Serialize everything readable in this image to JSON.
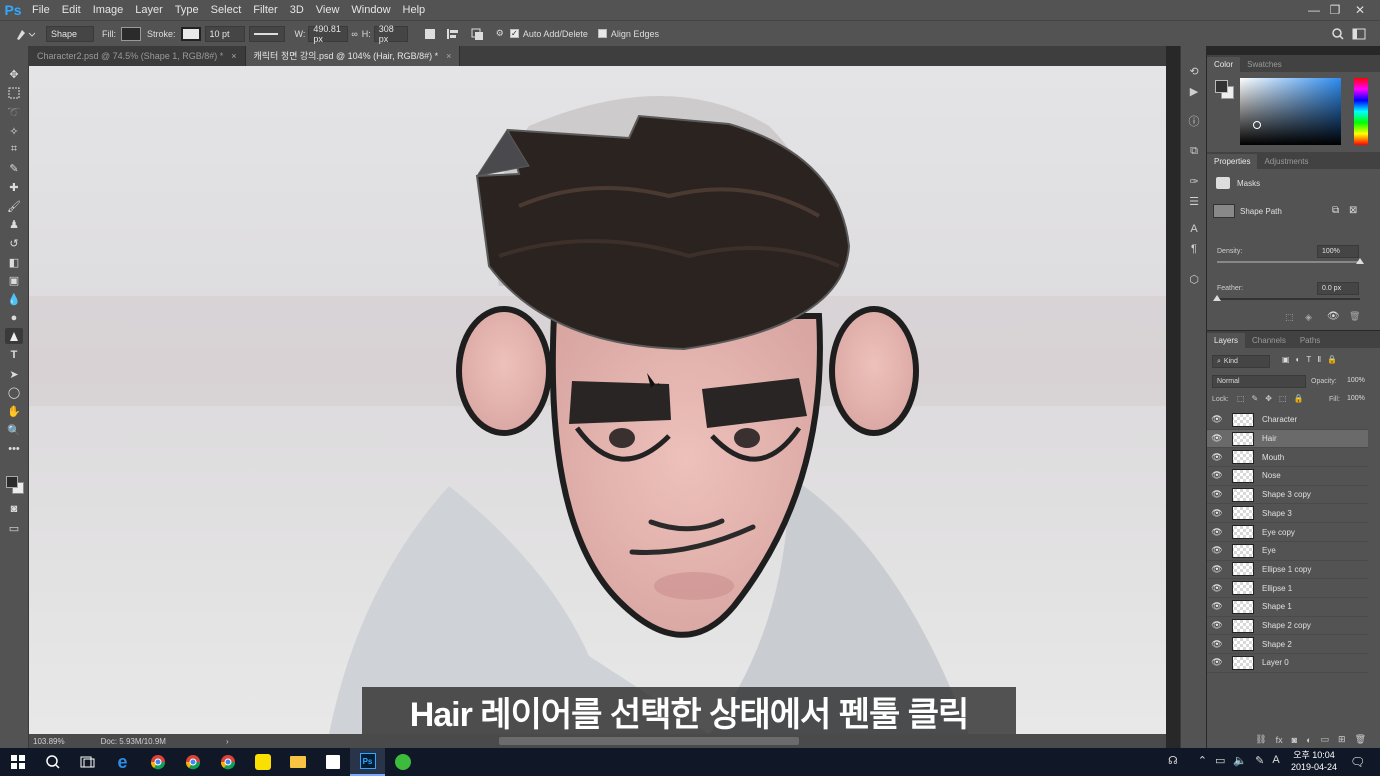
{
  "app": {
    "logo": "Ps"
  },
  "menu": [
    "File",
    "Edit",
    "Image",
    "Layer",
    "Type",
    "Select",
    "Filter",
    "3D",
    "View",
    "Window",
    "Help"
  ],
  "window_controls": {
    "minimize": "—",
    "restore": "❐",
    "close": "✕"
  },
  "options": {
    "tool_mode": "Shape",
    "fill_label": "Fill:",
    "stroke_label": "Stroke:",
    "stroke_width": "10 pt",
    "w_label": "W:",
    "w_value": "490.81 px",
    "h_label": "H:",
    "h_value": "308 px",
    "auto_add_delete": "Auto Add/Delete",
    "align_edges": "Align Edges"
  },
  "doc_tabs": [
    {
      "label": "Character2.psd @ 74.5% (Shape 1, RGB/8#) *",
      "close": "×"
    },
    {
      "label": "캐릭터 정면 강의.psd @ 104% (Hair, RGB/8#) *",
      "close": "×"
    }
  ],
  "status": {
    "zoom": "103.89%",
    "doc": "Doc: 5.93M/10.9M",
    "arrow": "›"
  },
  "color_panel": {
    "tabs": [
      "Color",
      "Swatches"
    ]
  },
  "properties_panel": {
    "tabs": [
      "Properties",
      "Adjustments"
    ],
    "masks_label": "Masks",
    "shape_path_label": "Shape Path",
    "density_label": "Density:",
    "density_value": "100%",
    "density": 1.0,
    "feather_label": "Feather:",
    "feather_value": "0.0 px",
    "feather": 0.0
  },
  "layers_panel": {
    "tabs": [
      "Layers",
      "Channels",
      "Paths"
    ],
    "kind_label": "Kind",
    "blend_mode": "Normal",
    "opacity_label": "Opacity:",
    "opacity_value": "100%",
    "lock_label": "Lock:",
    "fill_label": "Fill:",
    "fill_value": "100%",
    "layers": [
      {
        "name": "Character",
        "selected": false
      },
      {
        "name": "Hair",
        "selected": true
      },
      {
        "name": "Mouth",
        "selected": false
      },
      {
        "name": "Nose",
        "selected": false
      },
      {
        "name": "Shape 3 copy",
        "selected": false
      },
      {
        "name": "Shape 3",
        "selected": false
      },
      {
        "name": "Eye copy",
        "selected": false
      },
      {
        "name": "Eye",
        "selected": false
      },
      {
        "name": "Ellipse 1 copy",
        "selected": false
      },
      {
        "name": "Ellipse 1",
        "selected": false
      },
      {
        "name": "Shape 1",
        "selected": false
      },
      {
        "name": "Shape 2 copy",
        "selected": false
      },
      {
        "name": "Shape 2",
        "selected": false
      },
      {
        "name": "Layer 0",
        "selected": false
      }
    ]
  },
  "subtitle": "Hair 레이어를 선택한 상태에서 펜툴 클릭",
  "taskbar": {
    "time": "오후 10:04",
    "date": "2019-04-24",
    "lang": "A"
  },
  "colors": {
    "accent": "#31a8ff",
    "panel_bg": "#535353",
    "dark_bg": "#282828",
    "taskbar": "#101726"
  }
}
